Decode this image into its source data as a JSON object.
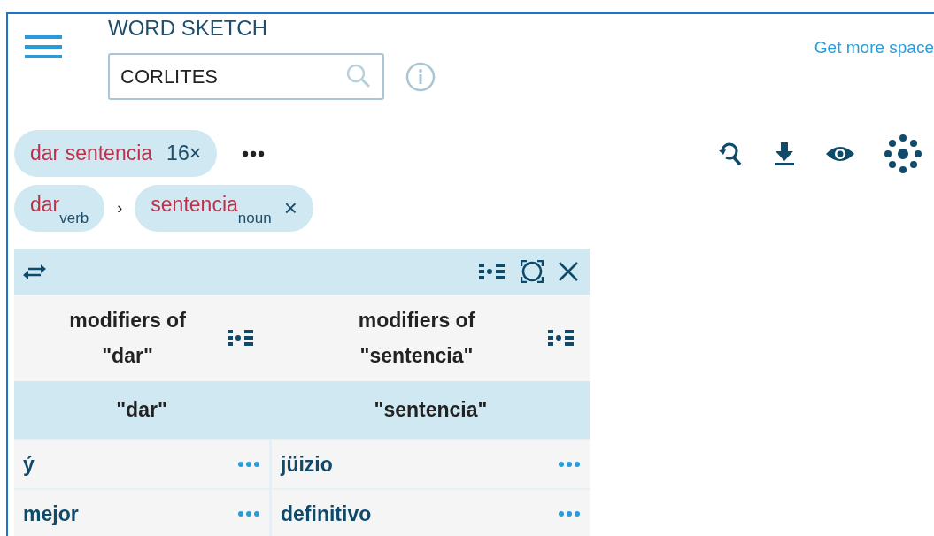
{
  "header": {
    "title": "WORD SKETCH",
    "search": {
      "value": "CORLITES"
    },
    "link": "Get more space"
  },
  "query": {
    "text": "dar sentencia",
    "count": "16×"
  },
  "breadcrumb": {
    "separator": "›",
    "items": [
      {
        "word": "dar",
        "pos": "verb",
        "removable": false
      },
      {
        "word": "sentencia",
        "pos": "noun",
        "removable": true,
        "remove": "×"
      }
    ]
  },
  "table": {
    "columns": [
      {
        "heading": "modifiers of \"dar\"",
        "subheading": "\"dar\"",
        "rows": [
          "ý",
          "mejor"
        ]
      },
      {
        "heading": "modifiers of \"sentencia\"",
        "subheading": "\"sentencia\"",
        "rows": [
          "jüizio",
          "definitivo"
        ]
      }
    ]
  }
}
